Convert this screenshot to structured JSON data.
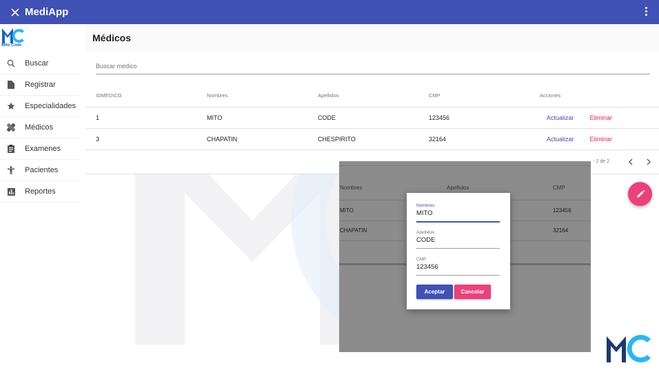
{
  "app": {
    "title": "MediApp"
  },
  "logo": {
    "text": "Mito Code"
  },
  "sidebar": {
    "items": [
      {
        "label": "Buscar",
        "icon": "search-icon"
      },
      {
        "label": "Registrar",
        "icon": "document-icon"
      },
      {
        "label": "Especialidades",
        "icon": "star-icon"
      },
      {
        "label": "Médicos",
        "icon": "bandage-icon"
      },
      {
        "label": "Examenes",
        "icon": "clipboard-icon"
      },
      {
        "label": "Pacientes",
        "icon": "person-icon"
      },
      {
        "label": "Reportes",
        "icon": "bar-chart-icon"
      }
    ]
  },
  "page": {
    "title": "Médicos"
  },
  "search": {
    "placeholder": "Buscar médico"
  },
  "table": {
    "headers": [
      "IDMEDICO",
      "Nombres",
      "Apellidos",
      "CMP",
      "Acciones"
    ],
    "rows": [
      {
        "id": "1",
        "nombres": "MITO",
        "apellidos": "CODE",
        "cmp": "123456"
      },
      {
        "id": "3",
        "nombres": "CHAPATIN",
        "apellidos": "CHESPIRITO",
        "cmp": "32164"
      }
    ],
    "actions": {
      "update": "Actualizar",
      "delete": "Eliminar"
    }
  },
  "paginator": {
    "range": "- 2 de 2"
  },
  "overlay": {
    "headers": [
      "Nombres",
      "Apellidos",
      "CMP"
    ],
    "rows": [
      {
        "nombres": "MITO",
        "cmp": "123456"
      },
      {
        "nombres": "CHAPATIN",
        "cmp": "32164"
      }
    ]
  },
  "dialog": {
    "fields": [
      {
        "label": "Nombres",
        "value": "MITO"
      },
      {
        "label": "Apellidos",
        "value": "CODE"
      },
      {
        "label": "CMP",
        "value": "123456"
      }
    ],
    "accept": "Aceptar",
    "cancel": "Cancelar"
  },
  "colors": {
    "primary": "#3f51b5",
    "accent": "#ec407a",
    "logo_blue": "#1565c0",
    "logo_cyan": "#29b6f6"
  }
}
